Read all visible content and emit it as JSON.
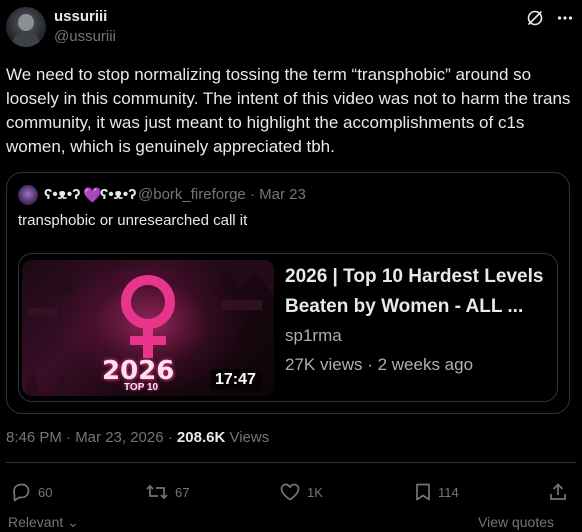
{
  "author": {
    "name": "ussuriii",
    "handle": "@ussuriii"
  },
  "post": {
    "text": "We need to stop normalizing tossing the term “transphobic” around so loosely in this community. The intent of this video was not to harm the trans community, it was just meant to highlight the accomplishments of c1s women, which is genuinely appreciated tbh."
  },
  "quote": {
    "name_left": "ʕ•ᴥ•ʔ",
    "heart": "💜",
    "name_right": "ʕ•ᴥ•ʔ",
    "handle_date": "@bork_fireforge · Mar 23",
    "text": "transphobic or unresearched call it",
    "video": {
      "title": "2026 | Top 10 Hardest Levels Beaten by Women - ALL ...",
      "channel": "sp1rma",
      "meta": "27K views · 2 weeks ago",
      "duration": "17:47",
      "thumb_year": "2026",
      "thumb_sub": "TOP 10"
    }
  },
  "timestamp": {
    "time_date": "8:46 PM · Mar 23, 2026 · ",
    "views_count": "208.6K",
    "views_label": " Views"
  },
  "actions": {
    "replies": "60",
    "reposts": "67",
    "likes": "1K",
    "views": "114"
  },
  "footer": {
    "left": "Relevant",
    "right": "View quotes"
  },
  "colors": {
    "background": "#000000",
    "text": "#e7e9ea",
    "muted": "#71767b",
    "border": "#2f3336",
    "accent_pink": "#e8358c"
  }
}
